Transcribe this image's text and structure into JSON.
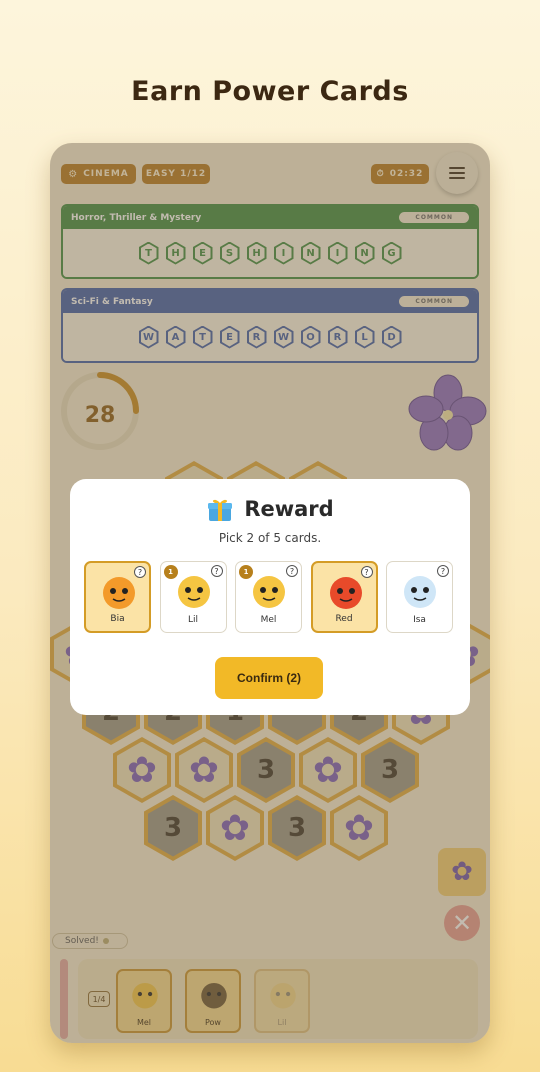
{
  "headline": "Earn Power Cards",
  "topbar": {
    "category": "CINEMA",
    "difficulty": "EASY 1/12",
    "time": "02:32"
  },
  "categories": [
    {
      "name": "Horror, Thriller & Mystery",
      "rarity": "COMMON",
      "letters": [
        "T",
        "H",
        "E",
        "S",
        "H",
        "I",
        "N",
        "I",
        "N",
        "G"
      ],
      "color": "#3e8b3e"
    },
    {
      "name": "Sci-Fi & Fantasy",
      "rarity": "COMMON",
      "letters": [
        "W",
        "A",
        "T",
        "E",
        "R",
        "W",
        "O",
        "R",
        "L",
        "D"
      ],
      "color": "#3f5ea8"
    }
  ],
  "counter": "28",
  "board_numbers": [
    "2",
    "2",
    "1",
    "2",
    "3",
    "3",
    "3",
    "3"
  ],
  "modal": {
    "title": "Reward",
    "subtitle": "Pick 2 of 5 cards.",
    "cards": [
      {
        "name": "Bia",
        "selected": true,
        "level": ""
      },
      {
        "name": "Lil",
        "selected": false,
        "level": "1"
      },
      {
        "name": "Mel",
        "selected": false,
        "level": "1"
      },
      {
        "name": "Red",
        "selected": true,
        "level": ""
      },
      {
        "name": "Isa",
        "selected": false,
        "level": ""
      }
    ],
    "confirm_label": "Confirm (2)"
  },
  "status": "Solved!",
  "tray": {
    "page": "1/4",
    "cards": [
      "Mel",
      "Pow",
      "Lil"
    ]
  }
}
